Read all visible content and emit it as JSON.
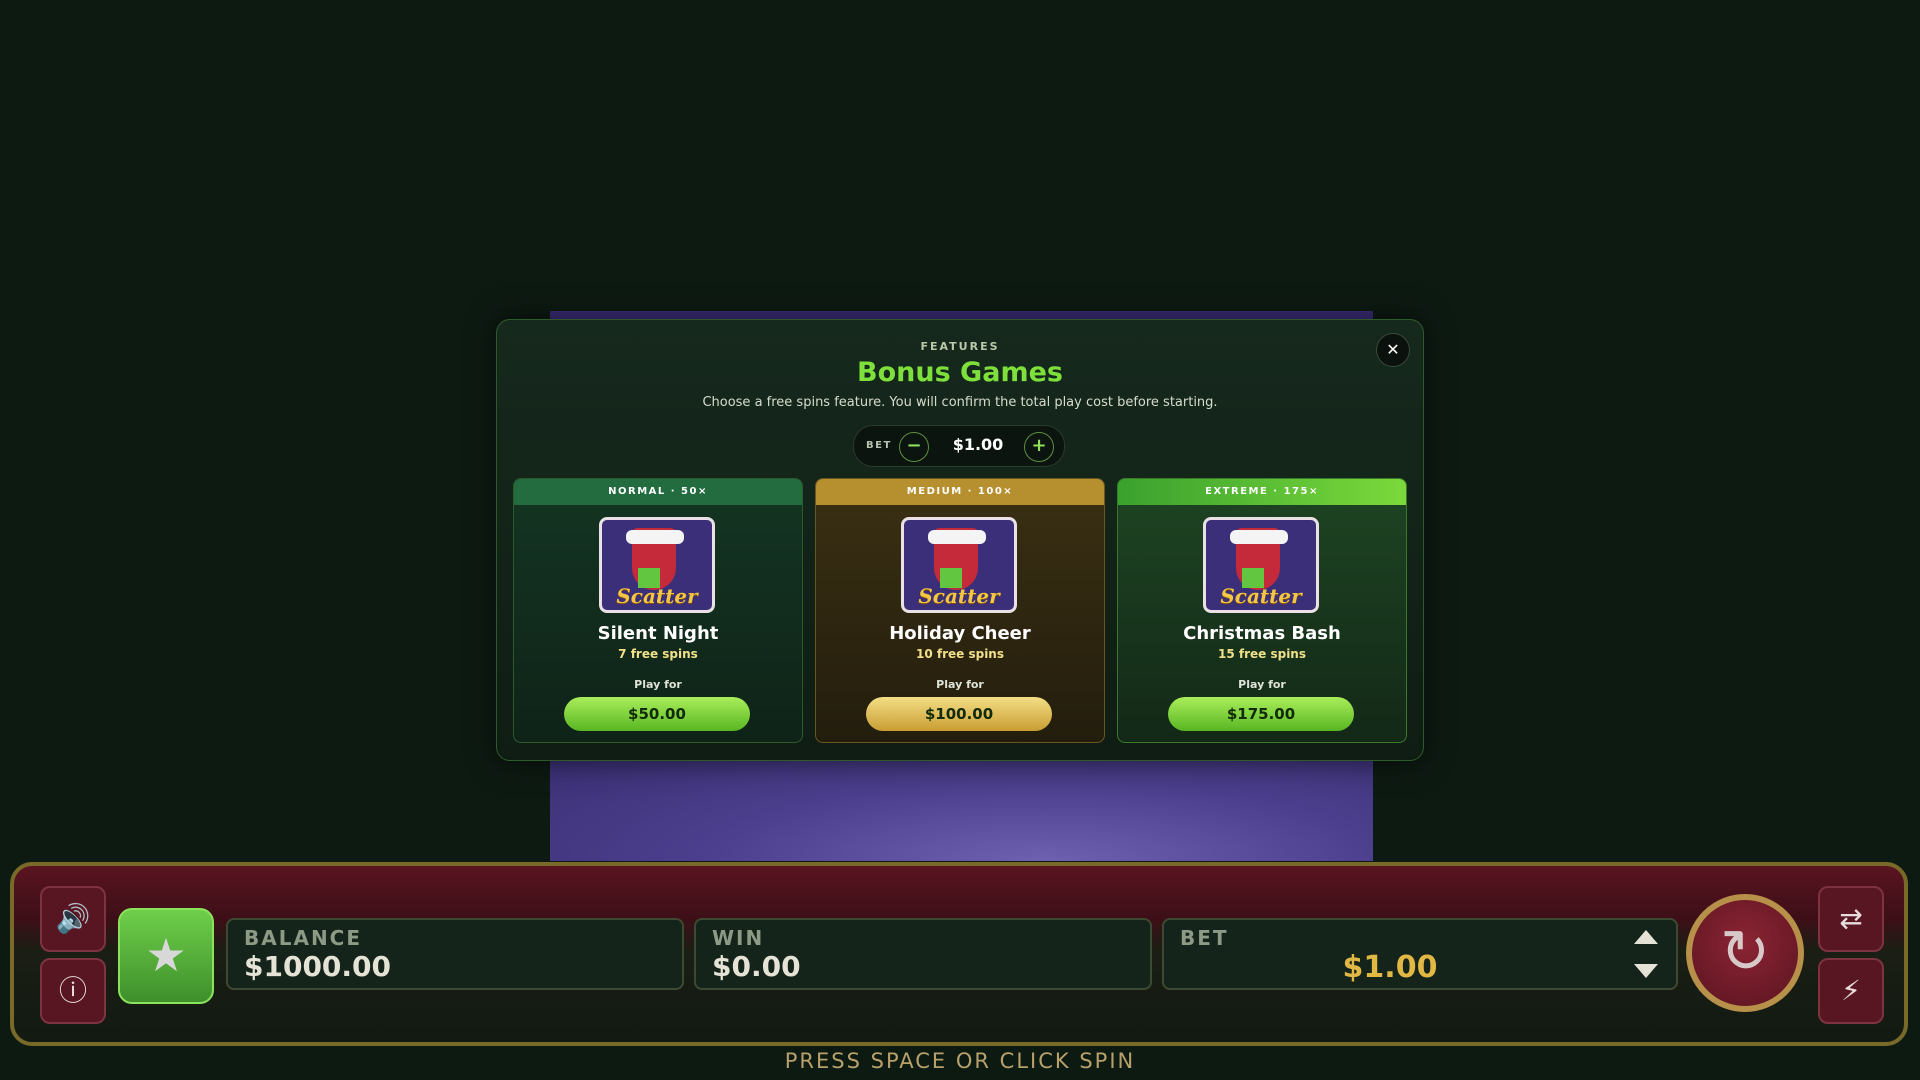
{
  "modal": {
    "eyebrow": "FEATURES",
    "title": "Bonus Games",
    "subtitle": "Choose a free spins feature. You will confirm the total play cost before starting.",
    "close_icon": "✕",
    "bet": {
      "label": "BET",
      "value": "$1.00",
      "minus": "−",
      "plus": "+"
    },
    "cards": [
      {
        "header": "NORMAL · 50×",
        "image_text": "Scatter",
        "name": "Silent Night",
        "spins_num": "7",
        "spins_text": " free spins",
        "play_label": "Play for",
        "price": "$50.00"
      },
      {
        "header": "MEDIUM · 100×",
        "image_text": "Scatter",
        "name": "Holiday Cheer",
        "spins_num": "10",
        "spins_text": " free spins",
        "play_label": "Play for",
        "price": "$100.00"
      },
      {
        "header": "EXTREME · 175×",
        "image_text": "Scatter",
        "name": "Christmas Bash",
        "spins_num": "15",
        "spins_text": " free spins",
        "play_label": "Play for",
        "price": "$175.00"
      }
    ]
  },
  "controls": {
    "balance_label": "BALANCE",
    "balance_value": "$1000.00",
    "win_label": "WIN",
    "win_value": "$0.00",
    "bet_label": "BET",
    "bet_value": "$1.00",
    "icons": {
      "sound": "speaker-icon",
      "info": "info-icon",
      "favorite": "star-icon",
      "spin": "spin-icon",
      "autoplay": "autoplay-icon",
      "turbo": "lightning-icon"
    },
    "glyphs": {
      "sound": "🔊",
      "info": "ⓘ",
      "star": "★",
      "spin": "↻",
      "auto": "⇄",
      "turbo": "⚡"
    }
  },
  "hint": "PRESS SPACE OR CLICK SPIN"
}
